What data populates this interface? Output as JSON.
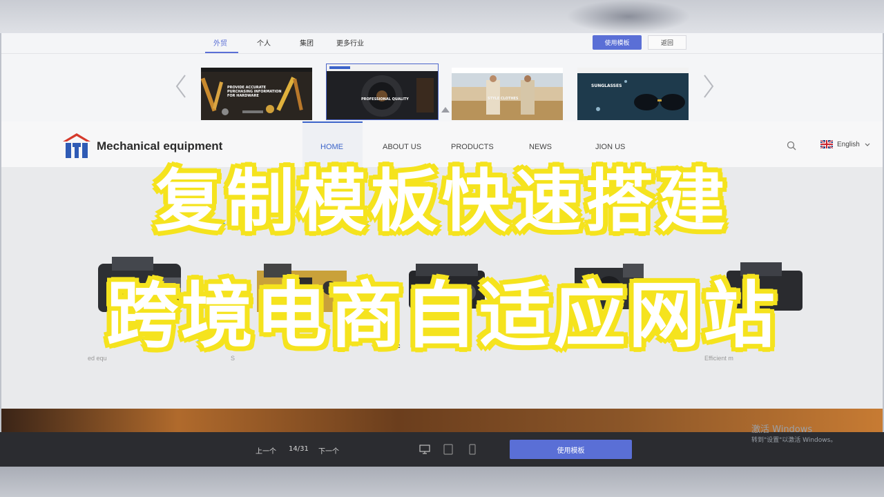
{
  "picker": {
    "tabs": [
      "外贸",
      "个人",
      "集团",
      "更多行业"
    ],
    "active_tab": "外贸",
    "use_template_label": "使用模板",
    "back_label": "返回",
    "thumbnails": [
      {
        "caption": "PROVIDE ACCURATE PURCHASING INFORMATION FOR HARDWARE"
      },
      {
        "caption": "PROFESSIONAL QUALITY"
      },
      {
        "caption": "STYLE CLOTHES"
      },
      {
        "caption": "SUNGLASSES"
      }
    ]
  },
  "site": {
    "logo_text": "Mechanical equipment",
    "nav": [
      "HOME",
      "ABOUT US",
      "PRODUCTS",
      "NEWS",
      "JION US"
    ],
    "active_nav": "HOME",
    "language": "English",
    "captions": [
      "ed equ",
      "S",
      "hic",
      "Efficient m"
    ]
  },
  "overlay": {
    "line1": "复制模板快速搭建",
    "line2": "跨境电商自适应网站"
  },
  "toolbar": {
    "prev_label": "上一个",
    "page": "14/31",
    "next_label": "下一个",
    "use_template_label": "使用模板"
  },
  "watermark": {
    "line1": "激活 Windows",
    "line2": "转到\"设置\"以激活 Windows。"
  },
  "colors": {
    "accent": "#5a6fd6",
    "nav_active": "#3b63c9",
    "overlay_fill": "#ffffff",
    "overlay_stroke": "#1b9ae6",
    "overlay_glow": "#f5e31e"
  }
}
